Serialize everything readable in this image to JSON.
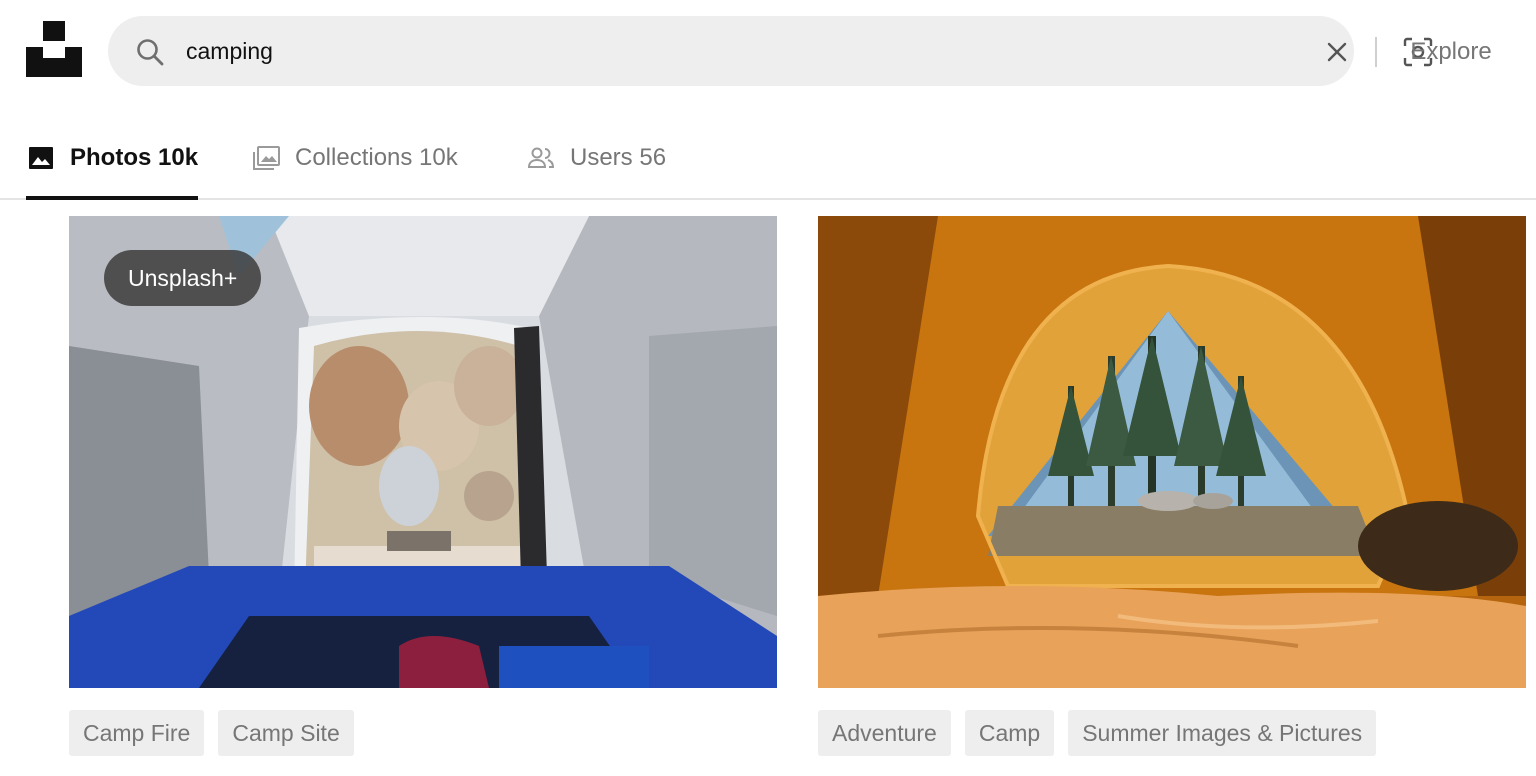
{
  "header": {
    "logo_icon": "unsplash-logo-icon",
    "search": {
      "value": "camping",
      "search_icon": "search-icon",
      "clear_icon": "close-icon",
      "visual_search_icon": "visual-search-icon"
    },
    "explore_label": "Explore"
  },
  "tabs": [
    {
      "label": "Photos 10k",
      "icon": "image-icon",
      "active": true
    },
    {
      "label": "Collections 10k",
      "icon": "collections-icon",
      "active": false
    },
    {
      "label": "Users 56",
      "icon": "users-icon",
      "active": false
    }
  ],
  "photos": [
    {
      "badge": "Unsplash+",
      "image": "tent-interior-boulders-photo",
      "tags": [
        "Camp Fire",
        "Camp Site"
      ]
    },
    {
      "badge": "",
      "image": "orange-tent-forest-photo",
      "tags": [
        "Adventure",
        "Camp",
        "Summer Images & Pictures"
      ]
    }
  ],
  "colors": {
    "search_bg": "#eeeeee",
    "muted_text": "#767676",
    "active_text": "#111111",
    "tag_bg": "#eeeeee"
  }
}
